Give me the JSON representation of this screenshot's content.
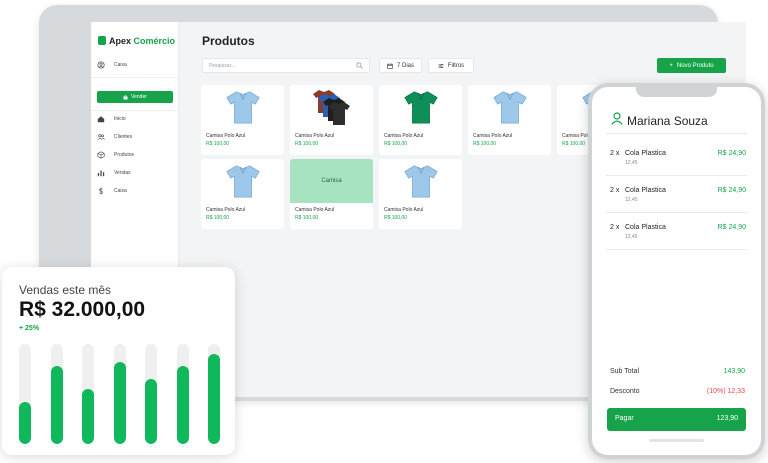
{
  "app": {
    "brand_prefix": "Apex ",
    "brand_accent": "Comércio",
    "accent_color": "#16a34a"
  },
  "sidebar": {
    "items": [
      {
        "label": "Caixa",
        "icon": "user-circle-icon"
      },
      {
        "label": "Vender",
        "icon": "bag-icon"
      },
      {
        "label": "Inicio",
        "icon": "home-icon"
      },
      {
        "label": "Clientes",
        "icon": "users-icon"
      },
      {
        "label": "Produtos",
        "icon": "box-icon"
      },
      {
        "label": "Vendas",
        "icon": "bar-chart-icon"
      },
      {
        "label": "Caixa",
        "icon": "dollar-icon"
      }
    ]
  },
  "main": {
    "title": "Produtos",
    "search_placeholder": "Pesquisar...",
    "filter_days": "7 Dias",
    "filter_label": "Filtros",
    "new_product": "Novo Produto",
    "products": [
      {
        "name": "Camisa Polo Azul",
        "price": "R$ 100,00",
        "image": "polo-blue"
      },
      {
        "name": "Camisa Polo Azul",
        "price": "R$ 100,00",
        "image": "polo-stack"
      },
      {
        "name": "Camisa Polo Azul",
        "price": "R$ 100,00",
        "image": "polo-green"
      },
      {
        "name": "Camisa Polo Azul",
        "price": "R$ 100,00",
        "image": "polo-blue"
      },
      {
        "name": "Camisa Polo Azul",
        "price": "R$ 100,00",
        "image": "polo-blue"
      },
      {
        "name": "Camisa Polo Azul",
        "price": "R$ 100,00",
        "image": "polo-blue"
      },
      {
        "name": "Camisa Polo Azul",
        "price": "R$ 100,00",
        "image": "polo-blue"
      },
      {
        "name": "Camisa Polo Azul",
        "price": "R$ 100,00",
        "image": "polo-blue"
      }
    ],
    "selected_label": "Camisa"
  },
  "sales": {
    "title": "Vendas este mês",
    "amount": "R$ 32.000,00",
    "change": "+ 25%",
    "bar_levels": [
      0.42,
      0.78,
      0.55,
      0.82,
      0.65,
      0.78,
      0.9
    ]
  },
  "phone": {
    "customer": "Mariana Souza",
    "items": [
      {
        "qty": "2 x",
        "name": "Cola Plastica",
        "price": "R$ 24,90",
        "unit": "12,45"
      },
      {
        "qty": "2 x",
        "name": "Cola Plastica",
        "price": "R$ 24,90",
        "unit": "12,45"
      },
      {
        "qty": "2 x",
        "name": "Cola Plastica",
        "price": "R$ 24,90",
        "unit": "12,45"
      }
    ],
    "subtotal_label": "Sub Total",
    "subtotal_value": "143,90",
    "discount_label": "Desconto",
    "discount_value": "(10%) 12,33",
    "pay_label": "Pagar",
    "pay_value": "123,90"
  }
}
